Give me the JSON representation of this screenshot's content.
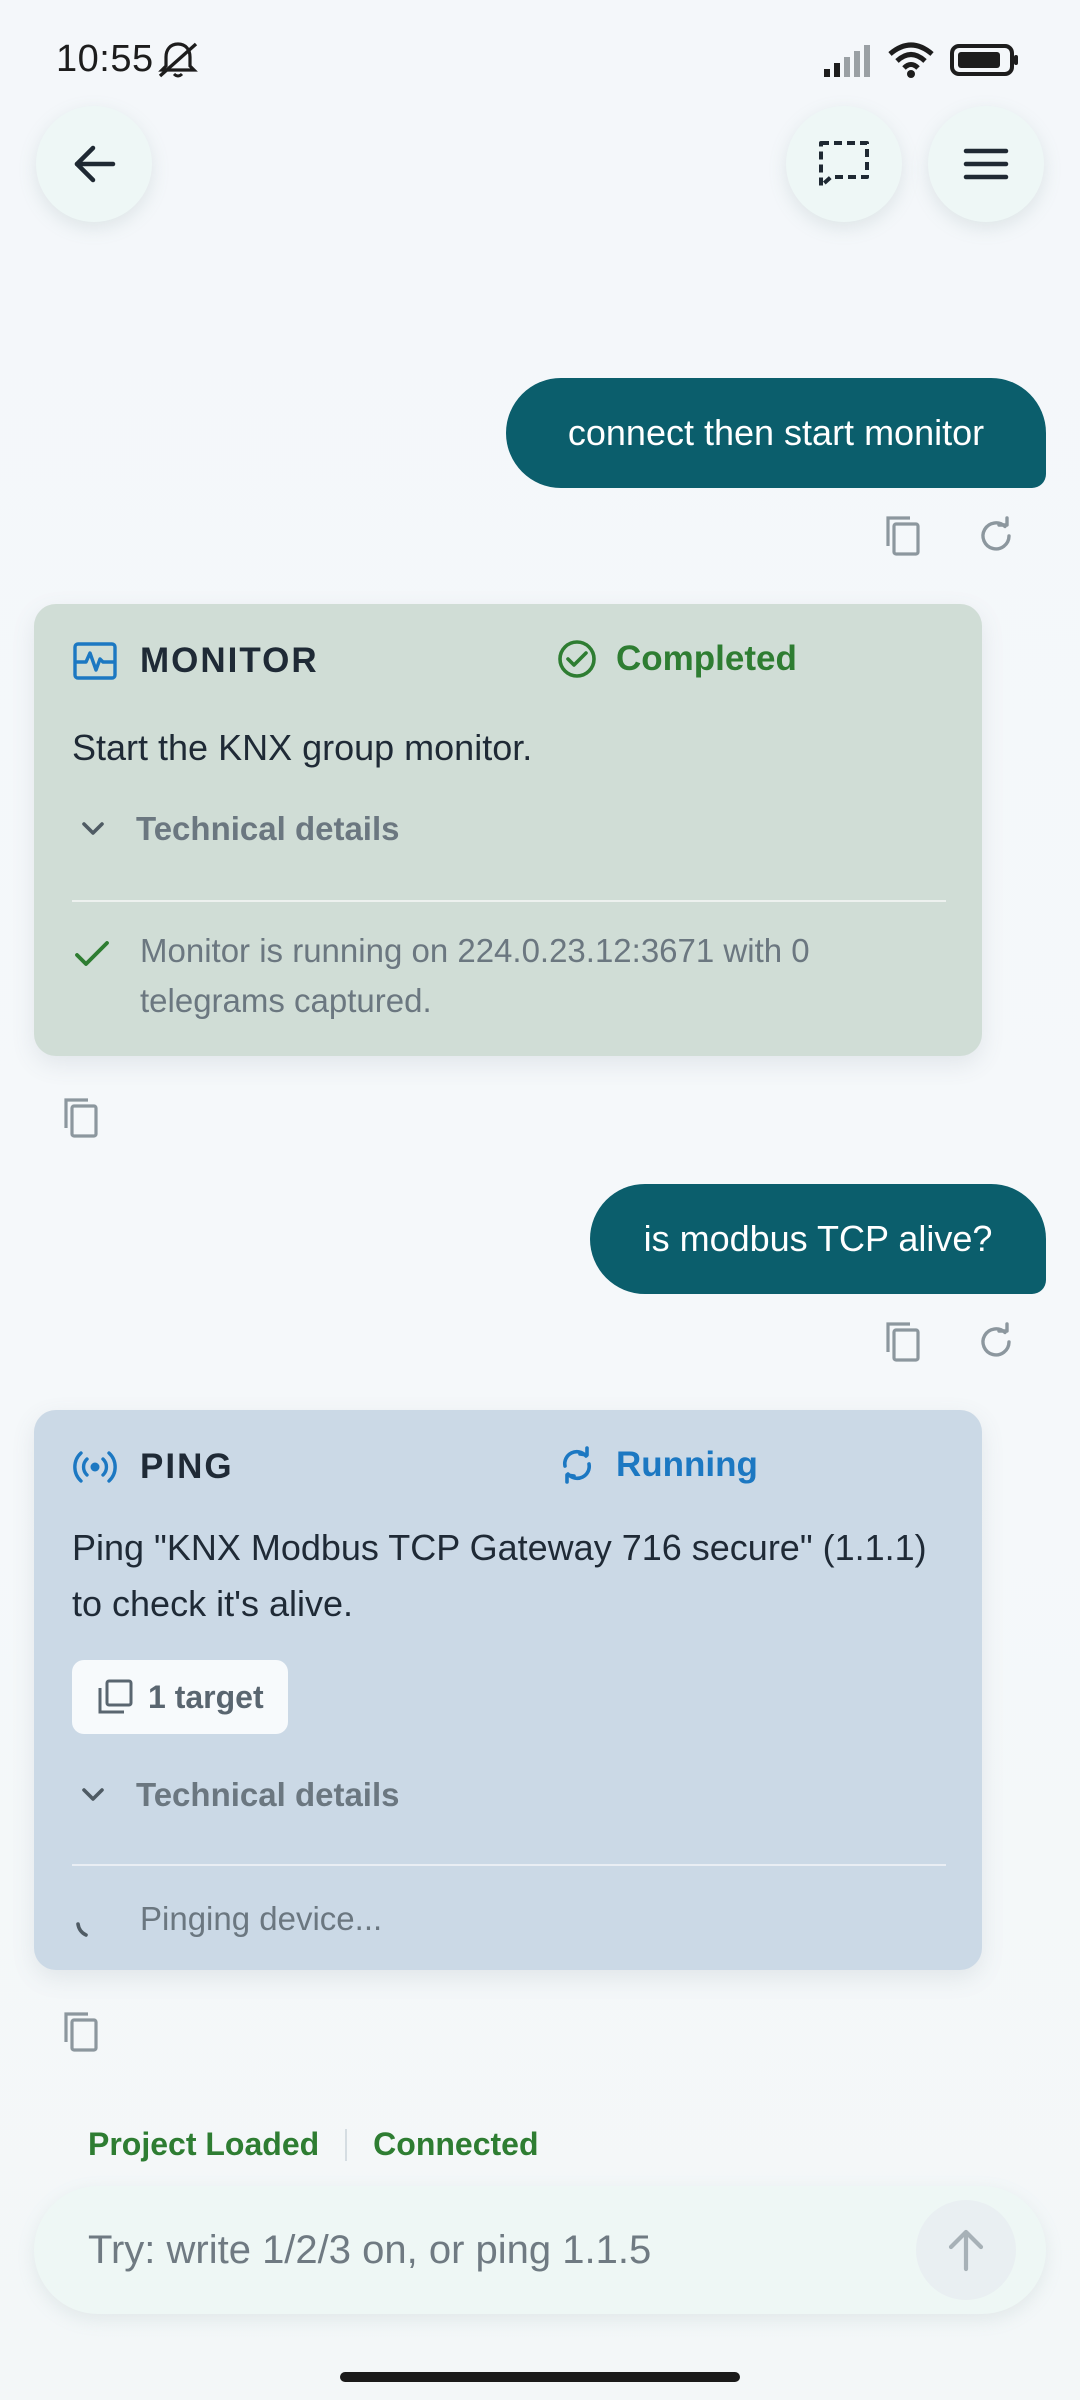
{
  "status_bar": {
    "time": "10:55"
  },
  "top_bar": {
    "back_icon": "arrow-left-icon",
    "feedback_icon": "feedback-icon",
    "menu_icon": "hamburger-menu-icon"
  },
  "messages": [
    {
      "role": "user",
      "text": "connect then start monitor"
    },
    {
      "role": "tool",
      "tool_name": "MONITOR",
      "status": "Completed",
      "description": "Start the KNX group monitor.",
      "details_label": "Technical details",
      "result": "Monitor is running on 224.0.23.12:3671 with 0 telegrams captured."
    },
    {
      "role": "user",
      "text": "is modbus TCP alive?"
    },
    {
      "role": "tool",
      "tool_name": "PING",
      "status": "Running",
      "description": "Ping \"KNX Modbus TCP Gateway 716 secure\" (1.1.1) to check it's alive.",
      "target_chip": "1 target",
      "details_label": "Technical details",
      "result": "Pinging device..."
    }
  ],
  "connection": {
    "project": "Project Loaded",
    "link": "Connected"
  },
  "composer": {
    "placeholder": "Try: write 1/2/3 on, or ping 1.1.5"
  },
  "colors": {
    "user_bubble": "#0b5e6c",
    "completed": "#2e7d32",
    "running": "#1c78c2",
    "monitor_card": "#d0ddd6",
    "ping_card": "#cbd9e6"
  }
}
